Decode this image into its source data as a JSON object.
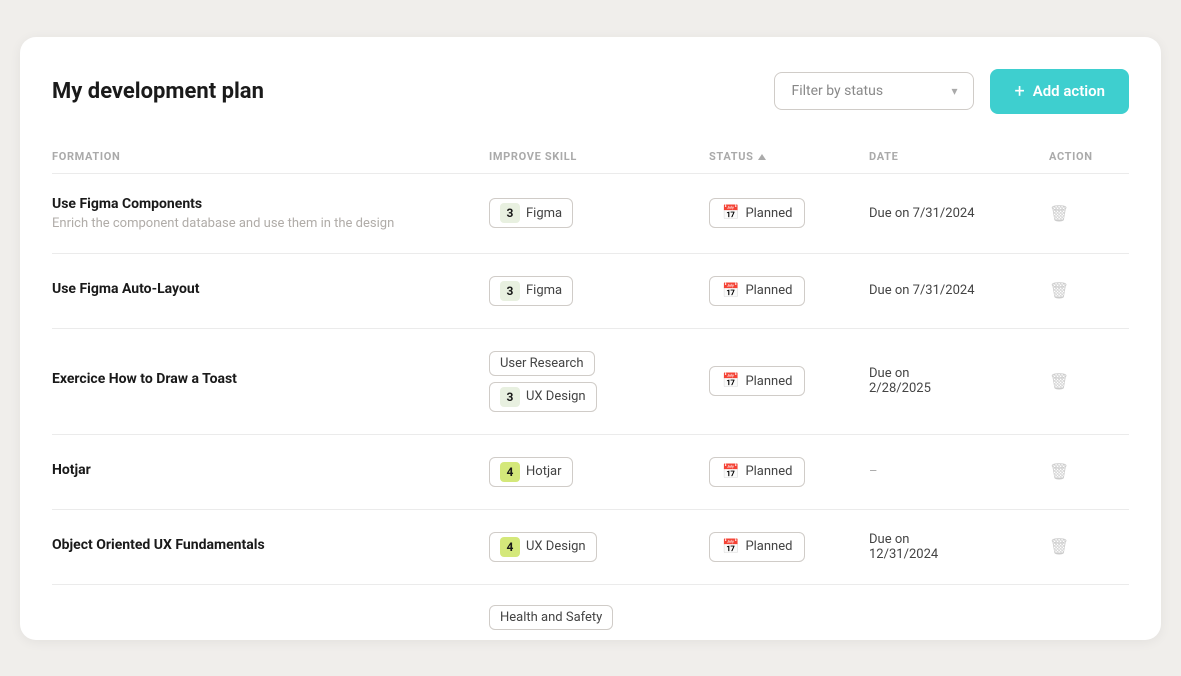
{
  "page": {
    "title": "My development plan",
    "filter_placeholder": "Filter by status",
    "add_action_label": "Add action"
  },
  "columns": {
    "formation": "Formation",
    "improve_skill": "Improve Skill",
    "status": "Status",
    "date": "Date",
    "action": "Action"
  },
  "rows": [
    {
      "id": 1,
      "title": "Use Figma Components",
      "subtitle": "Enrich the component database and use them in the design",
      "skills": [
        {
          "level": "3",
          "level_class": "level-3",
          "name": "Figma"
        }
      ],
      "status": "Planned",
      "date": "Due on 7/31/2024"
    },
    {
      "id": 2,
      "title": "Use Figma Auto-Layout",
      "subtitle": "",
      "skills": [
        {
          "level": "3",
          "level_class": "level-3",
          "name": "Figma"
        }
      ],
      "status": "Planned",
      "date": "Due on 7/31/2024"
    },
    {
      "id": 3,
      "title": "Exercice How to Draw a Toast",
      "subtitle": "",
      "skills": [
        {
          "level": "",
          "level_class": "",
          "name": "User Research"
        },
        {
          "level": "3",
          "level_class": "level-3",
          "name": "UX Design"
        }
      ],
      "status": "Planned",
      "date": "Due on 2/28/2025"
    },
    {
      "id": 4,
      "title": "Hotjar",
      "subtitle": "",
      "skills": [
        {
          "level": "4",
          "level_class": "level-4",
          "name": "Hotjar"
        }
      ],
      "status": "Planned",
      "date": "–"
    },
    {
      "id": 5,
      "title": "Object Oriented UX Fundamentals",
      "subtitle": "",
      "skills": [
        {
          "level": "4",
          "level_class": "level-4",
          "name": "UX Design"
        }
      ],
      "status": "Planned",
      "date": "Due on 12/31/2024"
    }
  ],
  "partial_row": {
    "skill_name": "Health and Safety"
  },
  "icons": {
    "plus": "+",
    "chevron_down": "▾",
    "calendar": "📅",
    "trash": "🗑"
  }
}
